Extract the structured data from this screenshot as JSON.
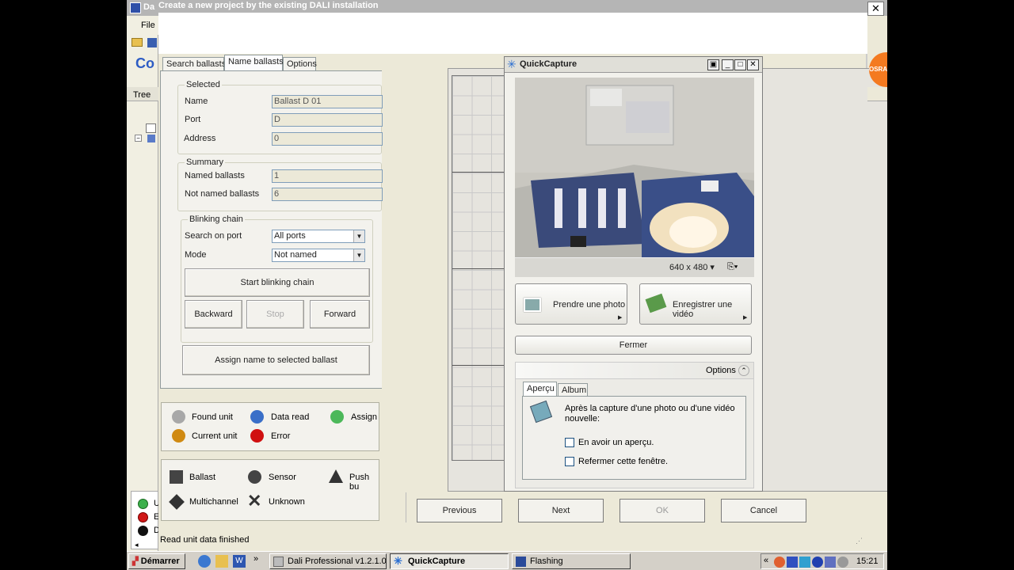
{
  "dali": {
    "title": "Da",
    "menu_file": "File",
    "co": "Co",
    "tree_label": "Tree",
    "left_letters": [
      "U",
      "E",
      "D"
    ]
  },
  "wizard": {
    "title": "Create a new project by the existing DALI installation",
    "tabs": [
      "Search ballasts",
      "Name ballasts",
      "Options"
    ],
    "active_tab": 1,
    "selected": {
      "group": "Selected",
      "name_label": "Name",
      "name_value": "Ballast D 01",
      "port_label": "Port",
      "port_value": "D",
      "address_label": "Address",
      "address_value": "0"
    },
    "summary": {
      "group": "Summary",
      "named_label": "Named ballasts",
      "named_value": "1",
      "not_named_label": "Not named ballasts",
      "not_named_value": "6"
    },
    "blinking": {
      "group": "Blinking chain",
      "search_label": "Search on port",
      "search_value": "All ports",
      "mode_label": "Mode",
      "mode_value": "Not named",
      "start_btn": "Start blinking chain",
      "backward_btn": "Backward",
      "stop_btn": "Stop",
      "forward_btn": "Forward"
    },
    "assign_btn": "Assign name to selected ballast",
    "legend_status": [
      {
        "label": "Found unit",
        "color": "#a8a8a8"
      },
      {
        "label": "Current unit",
        "color": "#d08a12"
      },
      {
        "label": "Data read",
        "color": "#3a6fc8"
      },
      {
        "label": "Error",
        "color": "#d01010"
      },
      {
        "label": "Assign",
        "color": "#4cb85a"
      }
    ],
    "legend_types": [
      "Ballast",
      "Sensor",
      "Push bu",
      "Multichannel",
      "Unknown"
    ],
    "nav": {
      "previous": "Previous",
      "next": "Next",
      "ok": "OK",
      "cancel": "Cancel"
    },
    "status_text": "Read unit data finished"
  },
  "quickcapture": {
    "title": "QuickCapture",
    "resolution": "640 x 480 ▾",
    "photo_btn": "Prendre une photo",
    "video_btn": "Enregistrer une vidéo",
    "close_btn": "Fermer",
    "options_label": "Options",
    "tab_preview": "Aperçu",
    "tab_album": "Album",
    "desc": "Après la capture d'une photo ou d'une vidéo nouvelle:",
    "check1": "En avoir un aperçu.",
    "check2": "Refermer cette fenêtre."
  },
  "taskbar": {
    "start": "Démarrer",
    "tasks": [
      "Dali Professional v1.2.1.0",
      "QuickCapture",
      "Flashing"
    ],
    "active_task": 1,
    "clock": "15:21",
    "chevron": "«",
    "quicklaunch_more": "»"
  },
  "brand": {
    "osram_text": "OSRA",
    "osram_color": "#f47a20"
  }
}
